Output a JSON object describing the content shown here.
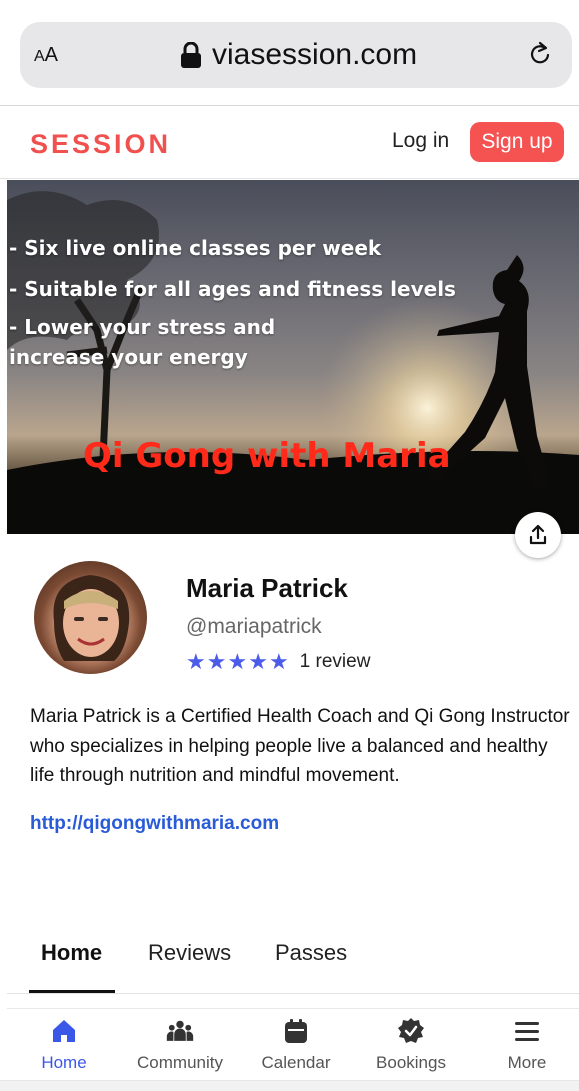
{
  "browser": {
    "aa_label_big": "A",
    "aa_label_small": "A",
    "url": "viasession.com"
  },
  "header": {
    "logo": "SESSION",
    "login_label": "Log in",
    "signup_label": "Sign up",
    "brand_color": "#f0504e"
  },
  "hero": {
    "lines": [
      "- Six live online classes per week",
      "- Suitable for all ages and fitness levels",
      "- Lower your stress and",
      "  increase your energy"
    ],
    "title": "Qi Gong with Maria"
  },
  "profile": {
    "name": "Maria Patrick",
    "handle": "@mariapatrick",
    "rating": 5,
    "reviews_label": "1 review",
    "bio": "Maria Patrick is a Certified Health Coach and Qi Gong Instructor who specializes in helping people live a balanced and healthy life through nutrition and mindful movement.",
    "link": "http://qigongwithmaria.com"
  },
  "tabs": [
    {
      "label": "Home",
      "active": true
    },
    {
      "label": "Reviews",
      "active": false
    },
    {
      "label": "Passes",
      "active": false
    }
  ],
  "bottom_nav": [
    {
      "label": "Home",
      "icon": "home-icon",
      "active": true
    },
    {
      "label": "Community",
      "icon": "community-icon",
      "active": false
    },
    {
      "label": "Calendar",
      "icon": "calendar-icon",
      "active": false
    },
    {
      "label": "Bookings",
      "icon": "bookings-icon",
      "active": false
    },
    {
      "label": "More",
      "icon": "menu-icon",
      "active": false
    }
  ],
  "colors": {
    "accent": "#3b57e8",
    "star": "#4b5ce8",
    "link": "#2a5bd7",
    "signup_bg": "#f55252"
  }
}
